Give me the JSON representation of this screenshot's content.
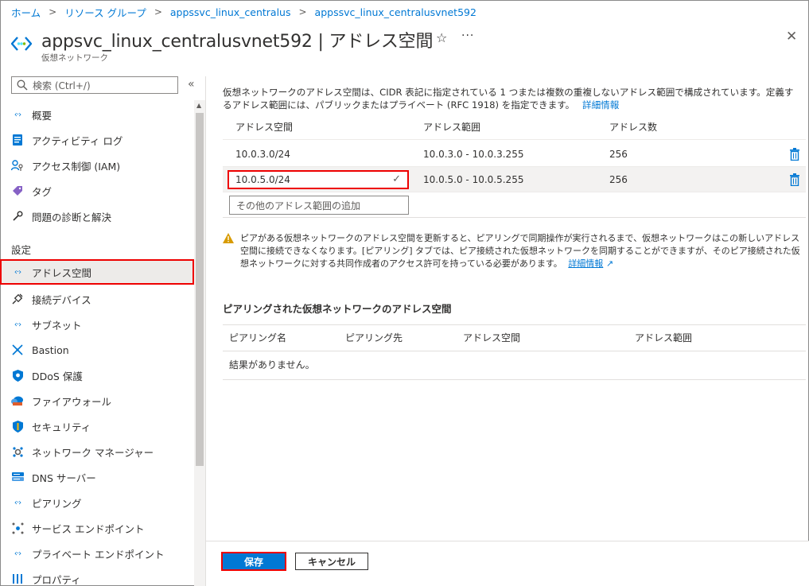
{
  "breadcrumb": [
    "ホーム",
    "リソース グループ",
    "appssvc_linux_centralus",
    "appssvc_linux_centralusvnet592"
  ],
  "header": {
    "title": "appsvc_linux_centralusvnet592 | アドレス空間",
    "subtitle": "仮想ネットワーク",
    "favorite_icon": "star-icon",
    "more_label": "···",
    "close_label": "✕"
  },
  "sidebar": {
    "search_placeholder": "検索 (Ctrl+/)",
    "collapse_label": "«",
    "section_label": "設定",
    "items": [
      {
        "label": "概要",
        "icon": "vnet-icon"
      },
      {
        "label": "アクティビティ ログ",
        "icon": "activity-log-icon"
      },
      {
        "label": "アクセス制御 (IAM)",
        "icon": "iam-icon"
      },
      {
        "label": "タグ",
        "icon": "tag-icon"
      },
      {
        "label": "問題の診断と解決",
        "icon": "wrench-icon"
      },
      {
        "label": "アドレス空間",
        "icon": "vnet-icon"
      },
      {
        "label": "接続デバイス",
        "icon": "plug-icon"
      },
      {
        "label": "サブネット",
        "icon": "vnet-icon"
      },
      {
        "label": "Bastion",
        "icon": "bastion-icon"
      },
      {
        "label": "DDoS 保護",
        "icon": "shield-icon"
      },
      {
        "label": "ファイアウォール",
        "icon": "firewall-icon"
      },
      {
        "label": "セキュリティ",
        "icon": "security-shield-icon"
      },
      {
        "label": "ネットワーク マネージャー",
        "icon": "network-manager-icon"
      },
      {
        "label": "DNS サーバー",
        "icon": "dns-icon"
      },
      {
        "label": "ピアリング",
        "icon": "peering-icon"
      },
      {
        "label": "サービス エンドポイント",
        "icon": "service-endpoint-icon"
      },
      {
        "label": "プライベート エンドポイント",
        "icon": "private-endpoint-icon"
      },
      {
        "label": "プロパティ",
        "icon": "properties-icon"
      }
    ]
  },
  "main": {
    "description": "仮想ネットワークのアドレス空間は、CIDR 表記に指定されている 1 つまたは複数の重複しないアドレス範囲で構成されています。定義するアドレス範囲には、パブリックまたはプライベート (RFC 1918) を指定できます。",
    "learn_more": "詳細情報",
    "columns": [
      "アドレス空間",
      "アドレス範囲",
      "アドレス数"
    ],
    "rows": [
      {
        "space": "10.0.3.0/24",
        "range": "10.0.3.0 - 10.0.3.255",
        "count": "256"
      },
      {
        "space": "10.0.5.0/24",
        "range": "10.0.5.0 - 10.0.5.255",
        "count": "256"
      }
    ],
    "add_placeholder": "その他のアドレス範囲の追加",
    "warning": "ピアがある仮想ネットワークのアドレス空間を更新すると、ピアリングで同期操作が実行されるまで、仮想ネットワークはこの新しいアドレス空間に接続できなくなります。[ピアリング] タブでは、ピア接続された仮想ネットワークを同期することができますが、そのピア接続された仮想ネットワークに対する共同作成者のアクセス許可を持っている必要があります。",
    "warning_link": "詳細情報",
    "peer_title": "ピアリングされた仮想ネットワークのアドレス空間",
    "peer_columns": [
      "ピアリング名",
      "ピアリング先",
      "アドレス空間",
      "アドレス範囲"
    ],
    "peer_empty": "結果がありません。"
  },
  "footer": {
    "save_label": "保存",
    "cancel_label": "キャンセル"
  },
  "colors": {
    "accent": "#0078d4",
    "highlight": "#ee0000",
    "warning": "#d89b00"
  }
}
